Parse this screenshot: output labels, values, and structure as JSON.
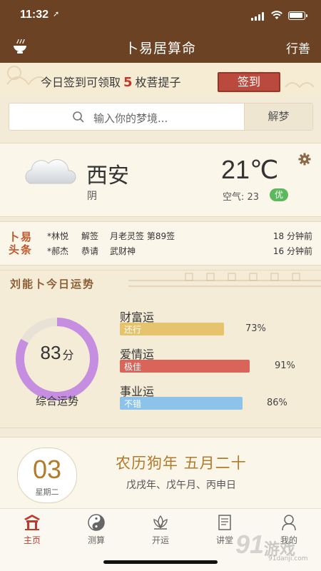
{
  "status_bar": {
    "time": "11:32",
    "location_icon": "location-arrow-icon"
  },
  "nav": {
    "title": "卜易居算命",
    "right_label": "行善",
    "left_icon": "bowl-icon"
  },
  "banner": {
    "text_pre": "今日签到可领取",
    "count": "5",
    "text_post": "枚菩提子",
    "button": "签到"
  },
  "dream_search": {
    "placeholder": "输入你的梦境...",
    "button": "解梦"
  },
  "weather": {
    "city": "西安",
    "condition": "阴",
    "temperature": "21℃",
    "air_label": "空气: 23",
    "air_quality": "优",
    "aqi_color": "#5cb85c"
  },
  "headlines": {
    "logo_line1": "卜易",
    "logo_line2": "头条",
    "items": [
      {
        "user": "*林悦",
        "action": "解签",
        "detail": "月老灵签 第89签",
        "time": "18 分钟前"
      },
      {
        "user": "*郝杰",
        "action": "恭请",
        "detail": "武财神",
        "time": "16 分钟前"
      }
    ]
  },
  "fortune": {
    "title": "刘能卜今日运势",
    "score": "83",
    "score_unit": "分",
    "score_fraction": 0.83,
    "overall_label": "综合运势",
    "ring_color": "#c58ee0",
    "metrics": [
      {
        "label": "财富运",
        "rating": "还行",
        "percent": "73%",
        "value": 0.73,
        "color": "#e6c46e"
      },
      {
        "label": "爱情运",
        "rating": "极佳",
        "percent": "91%",
        "value": 0.91,
        "color": "#d9645a"
      },
      {
        "label": "事业运",
        "rating": "不错",
        "percent": "86%",
        "value": 0.86,
        "color": "#8cc3ea"
      }
    ]
  },
  "calendar": {
    "day": "03",
    "weekday": "星期二",
    "lunar": "农历狗年 五月二十",
    "ganzhi": "戊戌年、戊午月、丙申日"
  },
  "tabs": [
    {
      "label": "主页",
      "icon": "home-icon",
      "active": true
    },
    {
      "label": "测算",
      "icon": "yin-yang-icon",
      "active": false
    },
    {
      "label": "开运",
      "icon": "lotus-icon",
      "active": false
    },
    {
      "label": "讲堂",
      "icon": "book-icon",
      "active": false
    },
    {
      "label": "我的",
      "icon": "monk-icon",
      "active": false
    }
  ],
  "watermark": {
    "main": "91",
    "brand": "游戏",
    "url": "91danji.com"
  }
}
